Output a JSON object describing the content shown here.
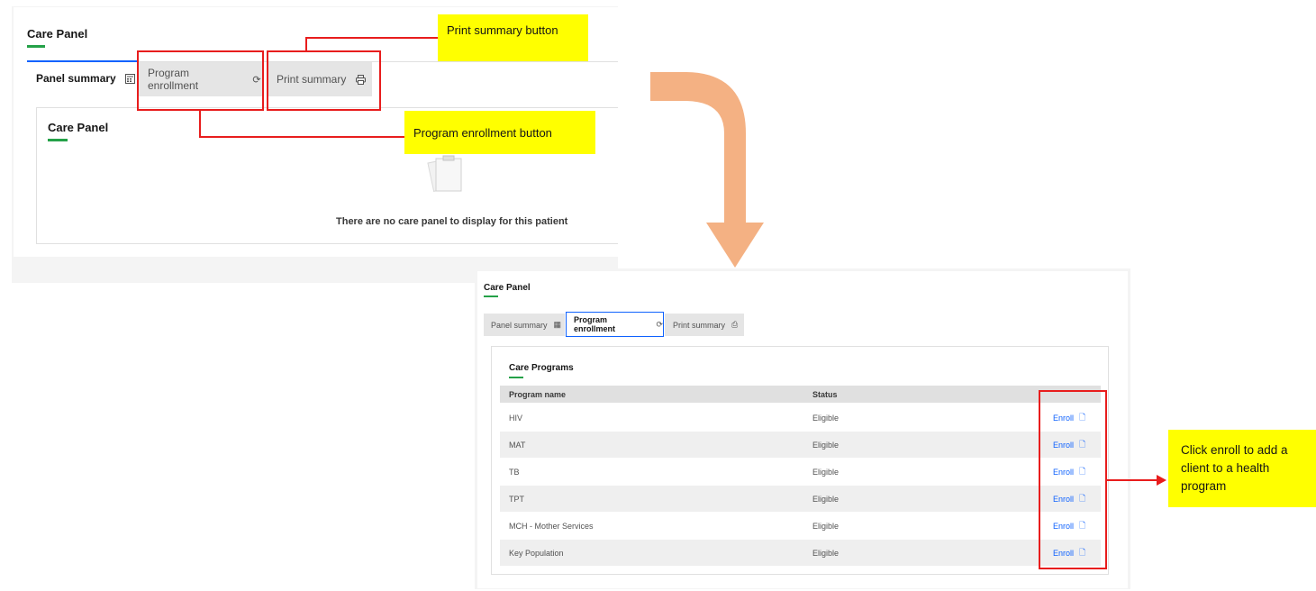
{
  "top_screen": {
    "title": "Care Panel",
    "tabs": [
      {
        "label": "Panel summary",
        "icon": "calculator-icon"
      },
      {
        "label": "Program enrollment",
        "icon": "refresh-icon"
      },
      {
        "label": "Print summary",
        "icon": "printer-icon"
      }
    ],
    "card": {
      "title": "Care Panel",
      "empty_message": "There are no care panel to display for this patient"
    }
  },
  "annotations": {
    "print_summary_note": "Print summary button",
    "program_enrollment_note": "Program enrollment button",
    "enroll_note": "Click enroll to add a client to a health program"
  },
  "bottom_screen": {
    "title": "Care Panel",
    "tabs": [
      {
        "label": "Panel summary"
      },
      {
        "label": "Program enrollment"
      },
      {
        "label": "Print summary"
      }
    ],
    "programs_title": "Care Programs",
    "columns": [
      "Program name",
      "Status"
    ],
    "rows": [
      {
        "program": "HIV",
        "status": "Eligible",
        "action": "Enroll"
      },
      {
        "program": "MAT",
        "status": "Eligible",
        "action": "Enroll"
      },
      {
        "program": "TB",
        "status": "Eligible",
        "action": "Enroll"
      },
      {
        "program": "TPT",
        "status": "Eligible",
        "action": "Enroll"
      },
      {
        "program": "MCH - Mother Services",
        "status": "Eligible",
        "action": "Enroll"
      },
      {
        "program": "Key Population",
        "status": "Eligible",
        "action": "Enroll"
      }
    ]
  },
  "colors": {
    "accent_green": "#24a148",
    "annotation_red": "#e81d1d",
    "note_yellow": "#ffff00",
    "arrow_orange": "#f4b183",
    "link_blue": "#0f62fe"
  }
}
